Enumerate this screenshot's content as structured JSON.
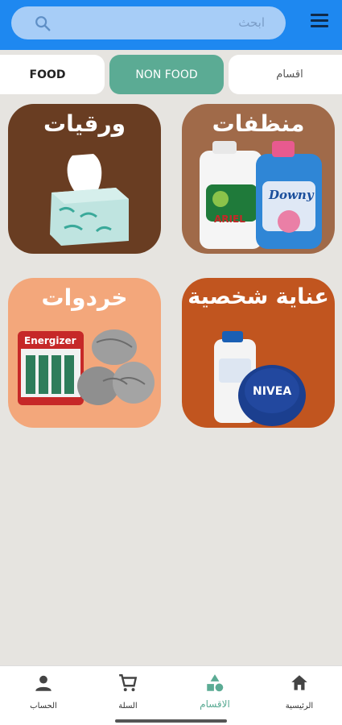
{
  "search": {
    "placeholder": "ابحث"
  },
  "tabs": [
    {
      "label": "FOOD"
    },
    {
      "label": "NON FOOD"
    },
    {
      "label": "اقسام"
    }
  ],
  "categories": [
    {
      "label": "منظفات",
      "brands": [
        "ARIEL",
        "Downy"
      ]
    },
    {
      "label": "ورقيات"
    },
    {
      "label": "عناية شخصية",
      "brands": [
        "NIVEA"
      ]
    },
    {
      "label": "خردوات",
      "brands": [
        "Energizer"
      ]
    }
  ],
  "bottom_nav": {
    "home": "الرئيسية",
    "categories": "الاقسام",
    "cart": "السلة",
    "account": "الحساب"
  },
  "colors": {
    "topbar": "#1e88f0",
    "accent": "#5bab94",
    "background": "#e6e4e0"
  }
}
